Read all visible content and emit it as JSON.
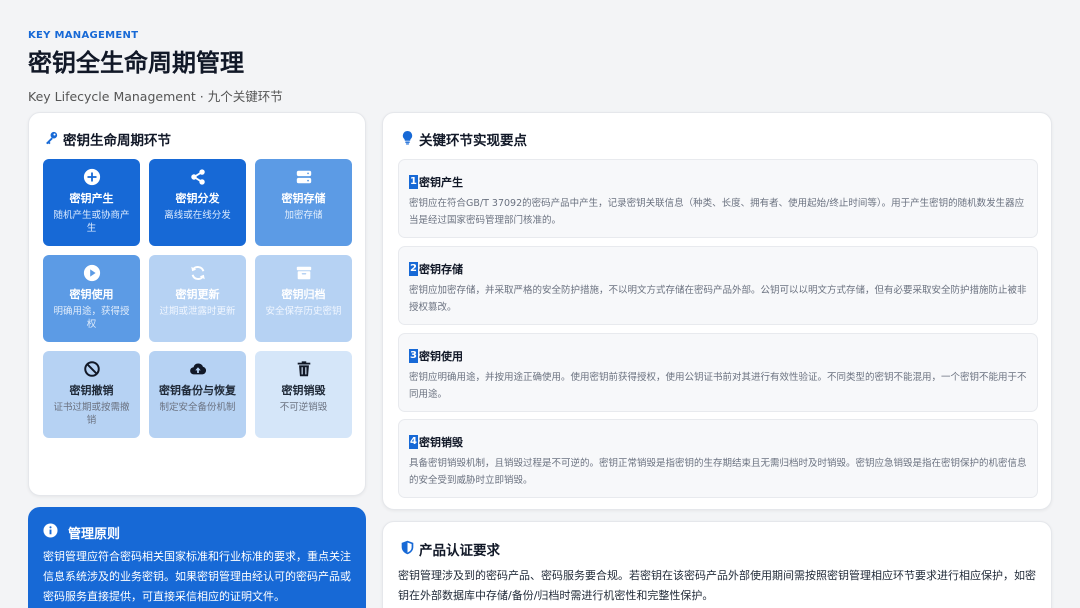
{
  "header": {
    "eyebrow": "KEY MANAGEMENT",
    "title": "密钥全生命周期管理",
    "subtitle": "Key Lifecycle Management · 九个关键环节"
  },
  "lifecycle": {
    "title": "密钥生命周期环节",
    "icon": "key-icon",
    "stages": [
      {
        "name": "密钥产生",
        "desc": "随机产生或协商产生",
        "icon": "plus-circle-icon"
      },
      {
        "name": "密钥分发",
        "desc": "离线或在线分发",
        "icon": "share-icon"
      },
      {
        "name": "密钥存储",
        "desc": "加密存储",
        "icon": "hdd-icon"
      },
      {
        "name": "密钥使用",
        "desc": "明确用途，获得授权",
        "icon": "play-circle-icon"
      },
      {
        "name": "密钥更新",
        "desc": "过期或泄露时更新",
        "icon": "refresh-icon"
      },
      {
        "name": "密钥归档",
        "desc": "安全保存历史密钥",
        "icon": "archive-icon"
      },
      {
        "name": "密钥撤销",
        "desc": "证书过期或按需撤销",
        "icon": "ban-icon"
      },
      {
        "name": "密钥备份与恢复",
        "desc": "制定安全备份机制",
        "icon": "cloud-upload-icon"
      },
      {
        "name": "密钥销毁",
        "desc": "不可逆销毁",
        "icon": "trash-icon"
      }
    ]
  },
  "principle": {
    "title": "管理原则",
    "icon": "info-icon",
    "text": "密钥管理应符合密码相关国家标准和行业标准的要求，重点关注信息系统涉及的业务密钥。如果密钥管理由经认可的密码产品或密码服务直接提供，可直接采信相应的证明文件。"
  },
  "points": {
    "title": "关键环节实现要点",
    "icon": "lightbulb-icon",
    "items": [
      {
        "num": "1",
        "title": "密钥产生",
        "desc": "密钥应在符合GB/T 37092的密码产品中产生，记录密钥关联信息（种类、长度、拥有者、使用起始/终止时间等）。用于产生密钥的随机数发生器应当是经过国家密码管理部门核准的。"
      },
      {
        "num": "2",
        "title": "密钥存储",
        "desc": "密钥应加密存储，并采取严格的安全防护措施，不以明文方式存储在密码产品外部。公钥可以以明文方式存储，但有必要采取安全防护措施防止被非授权篡改。"
      },
      {
        "num": "3",
        "title": "密钥使用",
        "desc": "密钥应明确用途，并按用途正确使用。使用密钥前获得授权，使用公钥证书前对其进行有效性验证。不同类型的密钥不能混用，一个密钥不能用于不同用途。"
      },
      {
        "num": "4",
        "title": "密钥销毁",
        "desc": "具备密钥销毁机制，且销毁过程是不可逆的。密钥正常销毁是指密钥的生存期结束且无需归档时及时销毁。密钥应急销毁是指在密钥保护的机密信息的安全受到威胁时立即销毁。"
      }
    ]
  },
  "certification": {
    "title": "产品认证要求",
    "icon": "shield-icon",
    "text": "密钥管理涉及到的密码产品、密码服务要合规。若密钥在该密码产品外部使用期间需按照密钥管理相应环节要求进行相应保护，如密钥在外部数据库中存储/备份/归档时需进行机密性和完整性保护。"
  },
  "colors": {
    "accent": "#1769d6",
    "tile_level_1": "#1769d6",
    "tile_level_2": "#5c9be5",
    "tile_level_3": "#b6d2f3",
    "tile_level_4": "#d5e6f9"
  }
}
